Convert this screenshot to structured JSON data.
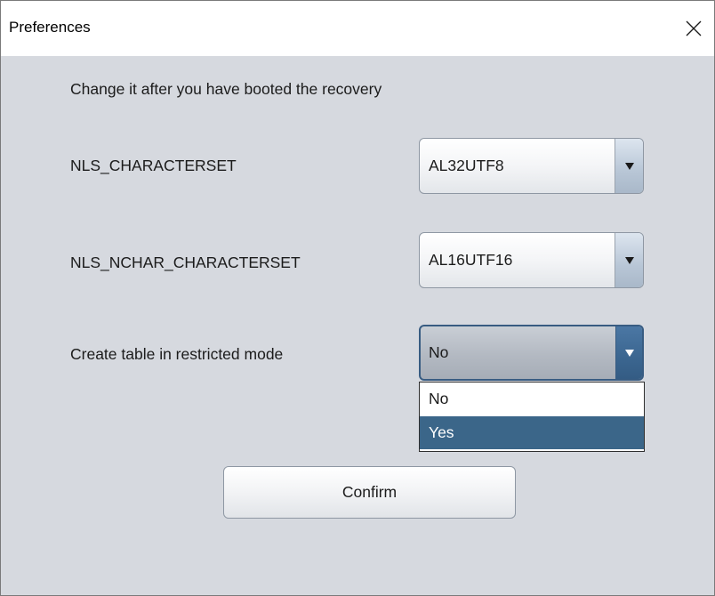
{
  "window": {
    "title": "Preferences"
  },
  "content": {
    "hint": "Change it after you have booted the recovery",
    "rows": [
      {
        "label": "NLS_CHARACTERSET",
        "value": "AL32UTF8"
      },
      {
        "label": "NLS_NCHAR_CHARACTERSET",
        "value": "AL16UTF16"
      },
      {
        "label": "Create table in restricted mode",
        "value": "No"
      }
    ],
    "dropdown_options": [
      "No",
      "Yes"
    ],
    "highlighted_option": "Yes",
    "confirm_label": "Confirm"
  },
  "icons": {
    "close": "close-icon",
    "arrow": "chevron-down-icon"
  },
  "colors": {
    "dialog_background": "#d6d9df",
    "selection": "#3b6689",
    "focus_border": "#385c82"
  }
}
